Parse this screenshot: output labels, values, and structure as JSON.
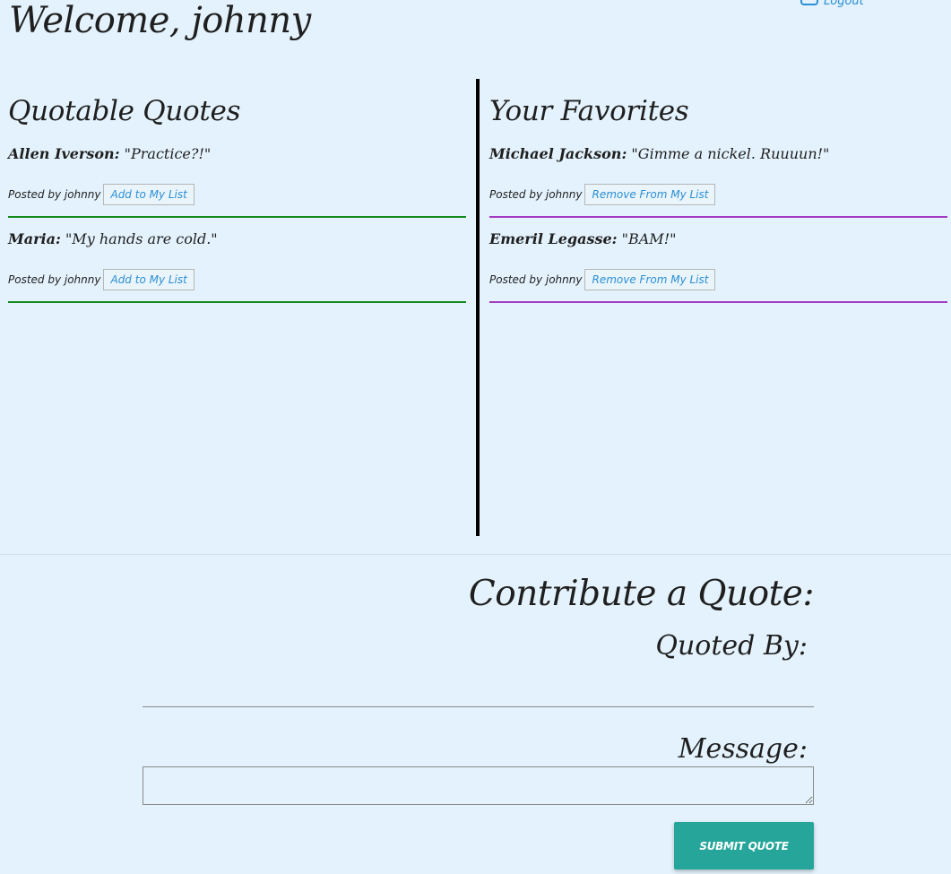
{
  "header": {
    "welcome": "Welcome, johnny",
    "logout_label": "Logout"
  },
  "quotable": {
    "title": "Quotable Quotes",
    "items": [
      {
        "author": "Allen Iverson:",
        "text": " \"Practice?!\"",
        "posted": "Posted by johnny",
        "action": "Add to My List"
      },
      {
        "author": "Maria:",
        "text": " \"My hands are cold.\"",
        "posted": "Posted by johnny",
        "action": "Add to My List"
      }
    ]
  },
  "favorites": {
    "title": "Your Favorites",
    "items": [
      {
        "author": "Michael Jackson:",
        "text": " \"Gimme a nickel. Ruuuun!\"",
        "posted": "Posted by johnny",
        "action": "Remove From My List"
      },
      {
        "author": "Emeril Legasse:",
        "text": " \"BAM!\"",
        "posted": "Posted by johnny",
        "action": "Remove From My List"
      }
    ]
  },
  "contribute": {
    "title": "Contribute a Quote:",
    "quoted_by_label": "Quoted By:",
    "quoted_by_value": "",
    "message_label": "Message:",
    "message_value": "",
    "submit_label": "SUBMIT QUOTE"
  },
  "colors": {
    "background": "#e3f2fc",
    "link": "#2b8fd6",
    "quote_rule": "#158a1c",
    "favorite_rule": "#a23bc2",
    "submit": "#26a69a"
  }
}
